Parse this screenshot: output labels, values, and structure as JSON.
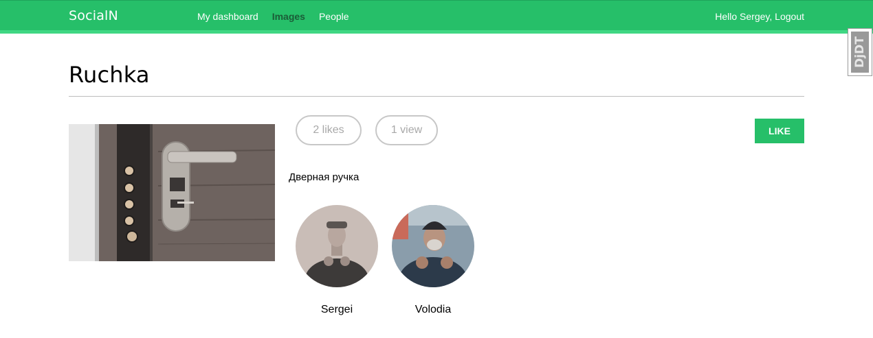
{
  "header": {
    "logo": "SocialN",
    "nav": [
      {
        "label": "My dashboard",
        "active": false
      },
      {
        "label": "Images",
        "active": true
      },
      {
        "label": "People",
        "active": false
      }
    ],
    "greeting": "Hello Sergey,",
    "logout": "Logout"
  },
  "debug_toolbar": {
    "label": "DjDT"
  },
  "image": {
    "title": "Ruchka",
    "likes_label": "2 likes",
    "views_label": "1 view",
    "like_button": "LIKE",
    "description": "Дверная ручка",
    "likers": [
      {
        "name": "Sergei"
      },
      {
        "name": "Volodia"
      }
    ]
  },
  "colors": {
    "brand": "#26bf69",
    "brand_light": "#3fd783",
    "active_nav": "#1b5c37",
    "pill_border": "#c7c7c7"
  }
}
